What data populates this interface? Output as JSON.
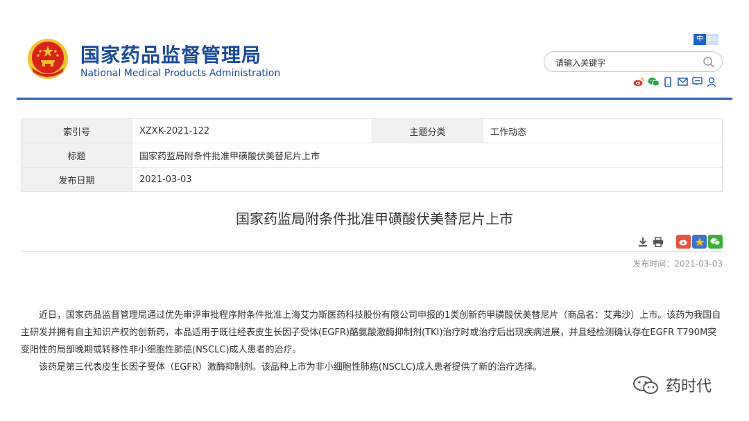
{
  "header": {
    "title_cn": "国家药品监督管理局",
    "title_en": "National Medical Products Administration",
    "lang_zh": "中",
    "lang_en": "En",
    "search_placeholder": "请输入关键字",
    "social_icons": [
      "weibo-icon",
      "wechat-icon",
      "mobile-icon",
      "mail-icon",
      "message-icon",
      "user-icon"
    ]
  },
  "meta": {
    "index_label": "索引号",
    "index_value": "XZXK-2021-122",
    "category_label": "主题分类",
    "category_value": "工作动态",
    "title_label": "标题",
    "title_value": "国家药监局附条件批准甲磺酸伏美替尼片上市",
    "date_label": "发布日期",
    "date_value": "2021-03-03"
  },
  "article": {
    "title": "国家药监局附条件批准甲磺酸伏美替尼片上市",
    "publish_time": "发布时间：2021-03-03",
    "paragraphs": [
      "近日，国家药品监督管理局通过优先审评审批程序附条件批准上海艾力斯医药科技股份有限公司申报的1类创新药甲磺酸伏美替尼片（商品名：艾弗沙）上市。该药为我国自主研发并拥有自主知识产权的创新药，本品适用于既往经表皮生长因子受体(EGFR)酪氨酸激酶抑制剂(TKI)治疗时或治疗后出现疾病进展，并且经检测确认存在EGFR T790M突变阳性的局部晚期或转移性非小细胞性肺癌(NSCLC)成人患者的治疗。",
      "该药是第三代表皮生长因子受体（EGFR）激酶抑制剂。该品种上市为非小细胞性肺癌(NSCLC)成人患者提供了新的治疗选择。"
    ]
  },
  "watermark": {
    "text": "药时代"
  },
  "colors": {
    "brand_blue": "#1b4a9a",
    "rule_blue": "#2d61b0",
    "emblem_red": "#d8231a",
    "emblem_gold": "#f2c230"
  }
}
